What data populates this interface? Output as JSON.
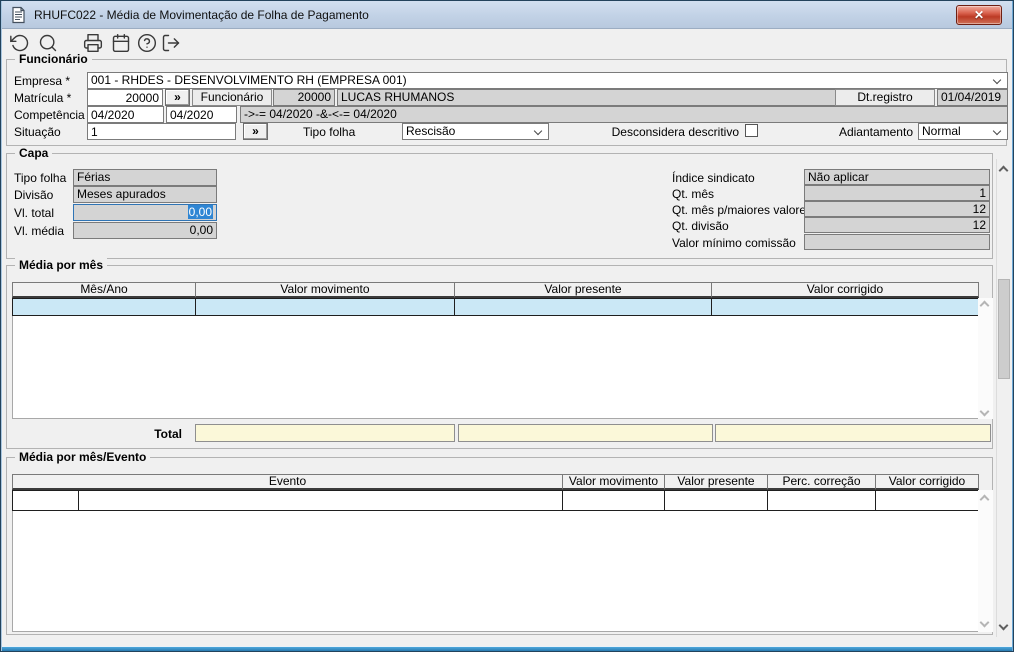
{
  "window": {
    "title": "RHUFC022 - Média de Movimentação de Folha de Pagamento"
  },
  "icons": {
    "close": "✕",
    "lookup": "»"
  },
  "colors": {
    "titlebar_top": "#d2dff0",
    "titlebar_bottom": "#b8c9de",
    "close_red": "#bc3a25",
    "readonly_gray": "#d4d4d4",
    "selected_row": "#cbe8f6",
    "selection_blue": "#2f86d4",
    "total_field_yellow": "#fbf8d9",
    "frame_blue": "#4ea8dc"
  },
  "toolbar": {
    "icons": [
      "undo-icon",
      "search-icon",
      "print-icon",
      "calendar-icon",
      "help-icon",
      "exit-icon"
    ]
  },
  "funcionario": {
    "group_label": "Funcionário",
    "empresa_label": "Empresa *",
    "empresa_value": "001 - RHDES - DESENVOLVIMENTO RH (EMPRESA 001)",
    "matricula_label": "Matrícula *",
    "matricula_value": "20000",
    "funcionario_field_label": "Funcionário",
    "funcionario_codigo": "20000",
    "funcionario_nome": "LUCAS RHUMANOS",
    "dt_registro_label": "Dt.registro",
    "dt_registro_value": "01/04/2019",
    "competencia_label": "Competência *",
    "competencia_inicio": "04/2020",
    "competencia_fim": "04/2020",
    "competencia_info": "->-= 04/2020 -&-<-= 04/2020",
    "situacao_label": "Situação",
    "situacao_value": "1",
    "tipo_folha_label": "Tipo folha",
    "tipo_folha_value": "Rescisão",
    "desconsidera_descritivo_label": "Desconsidera descritivo",
    "adiantamento_label": "Adiantamento",
    "adiantamento_value": "Normal"
  },
  "capa": {
    "group_label": "Capa",
    "tipo_folha_label": "Tipo folha",
    "tipo_folha_value": "Férias",
    "divisao_label": "Divisão",
    "divisao_value": "Meses apurados",
    "vl_total_label": "Vl. total",
    "vl_total_value": "0,00",
    "vl_media_label": "Vl. média",
    "vl_media_value": "0,00",
    "indice_sindicato_label": "Índice sindicato",
    "indice_sindicato_value": "Não aplicar",
    "qt_mes_label": "Qt. mês",
    "qt_mes_value": "1",
    "qt_mes_maiores_label": "Qt. mês p/maiores valores",
    "qt_mes_maiores_value": "12",
    "qt_divisao_label": "Qt. divisão",
    "qt_divisao_value": "12",
    "valor_minimo_label": "Valor mínimo comissão",
    "valor_minimo_value": ""
  },
  "media_mes": {
    "group_label": "Média por mês",
    "columns": [
      "Mês/Ano",
      "Valor movimento",
      "Valor presente",
      "Valor corrigido"
    ],
    "rows": [
      {
        "mes_ano": "",
        "valor_movimento": "",
        "valor_presente": "",
        "valor_corrigido": ""
      }
    ],
    "total_label": "Total",
    "totals": [
      "",
      "",
      ""
    ]
  },
  "media_evento": {
    "group_label": "Média por mês/Evento",
    "columns": [
      "Evento",
      "Valor movimento",
      "Valor presente",
      "Perc. correção",
      "Valor corrigido"
    ],
    "rows": [
      {
        "codigo": "",
        "descricao": "",
        "valor_movimento": "",
        "valor_presente": "",
        "perc_correcao": "",
        "valor_corrigido": ""
      }
    ]
  }
}
